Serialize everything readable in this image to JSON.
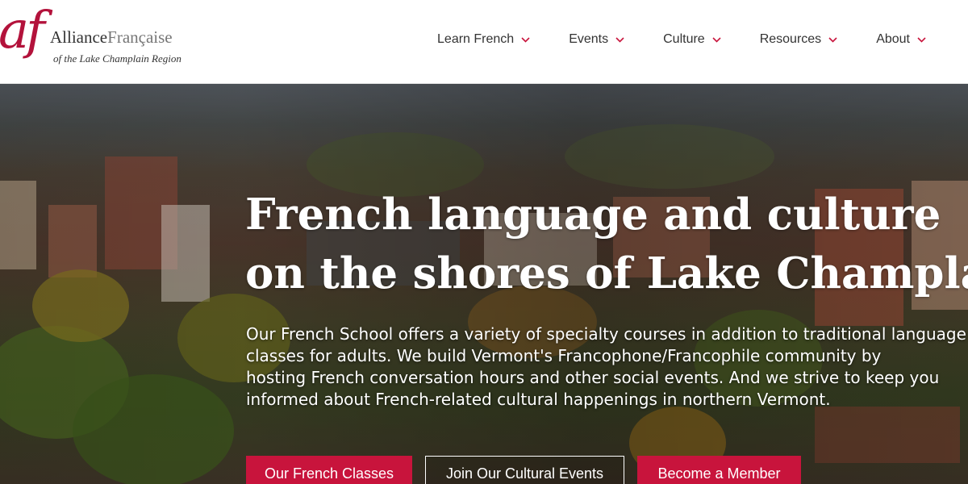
{
  "brand": {
    "mark": "af",
    "name_part1": "Alliance",
    "name_part2": "Française",
    "tagline_prefix": "of the",
    "tagline": "Lake Champlain Region",
    "color": "#b3123b"
  },
  "nav": {
    "items": [
      {
        "label": "Learn French",
        "icon": "chevron-down-icon"
      },
      {
        "label": "Events",
        "icon": "chevron-down-icon"
      },
      {
        "label": "Culture",
        "icon": "chevron-down-icon"
      },
      {
        "label": "Resources",
        "icon": "chevron-down-icon"
      },
      {
        "label": "About",
        "icon": "chevron-down-icon"
      }
    ],
    "chevron_color": "#c8143c"
  },
  "hero": {
    "headline_line1": "French language and culture",
    "headline_line2": "on the shores of Lake Champlain",
    "intro_lines": [
      "Our French School offers a variety of specialty courses in addition to traditional language",
      "classes for adults. We build Vermont's Francophone/Francophile community by",
      "hosting French conversation hours and other social events. And we strive to keep you",
      "informed about French-related cultural happenings in northern Vermont."
    ],
    "buttons": {
      "classes": "Our French Classes",
      "events": "Join Our Cultural Events",
      "member": "Become a Member"
    },
    "accent": "#c8143c"
  }
}
